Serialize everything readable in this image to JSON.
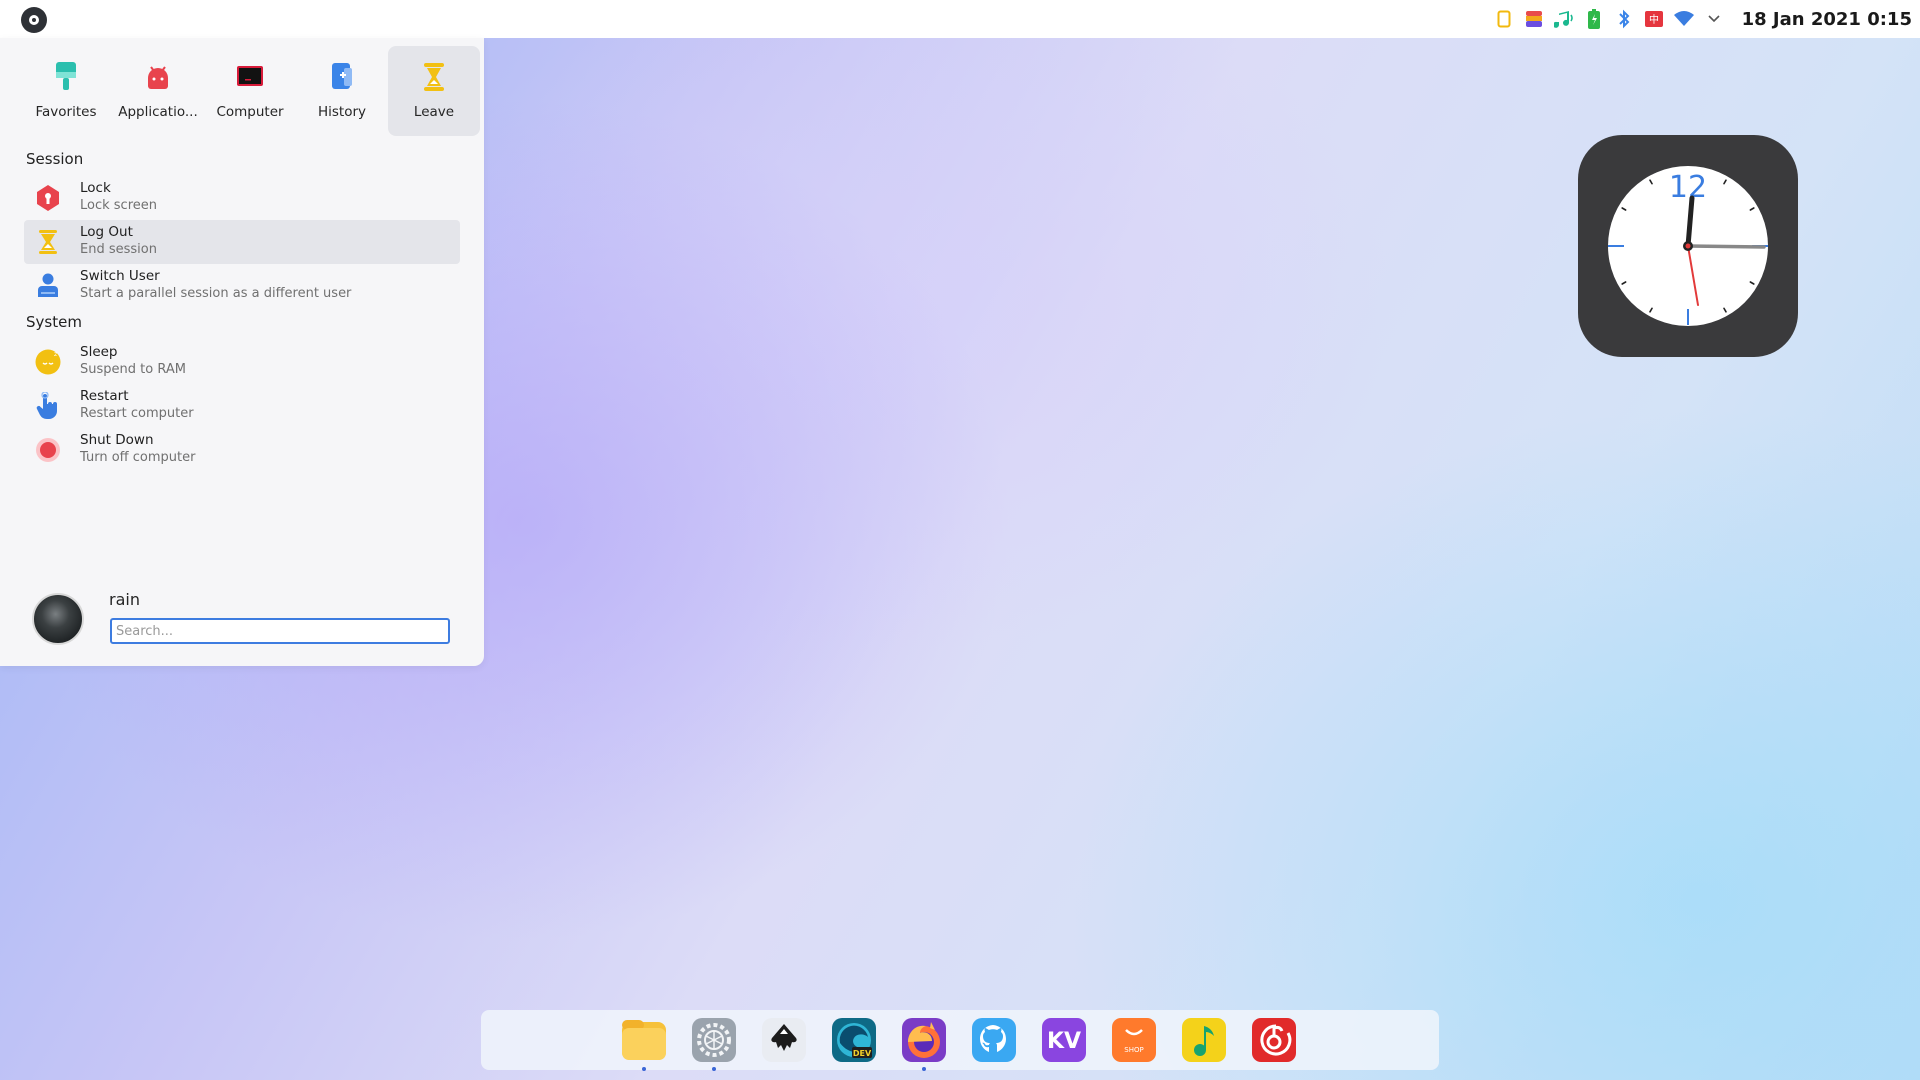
{
  "top_panel": {
    "launcher_icon": "deepin-launcher-icon",
    "tray_icons": [
      "clipboard-icon",
      "app-grid-icon",
      "music-note-icon",
      "battery-icon",
      "bluetooth-icon",
      "input-method-icon",
      "wifi-icon",
      "chevron-down-icon"
    ],
    "datetime": "18 Jan 2021 0:15"
  },
  "start_menu": {
    "tabs": [
      {
        "label": "Favorites",
        "icon": "bookmark-icon",
        "color": "#2bbfae"
      },
      {
        "label": "Applicatio...",
        "icon": "android-icon",
        "color": "#e8434d"
      },
      {
        "label": "Computer",
        "icon": "monitor-icon",
        "color": "#d81b3a"
      },
      {
        "label": "History",
        "icon": "document-icon",
        "color": "#3a84e8"
      },
      {
        "label": "Leave",
        "icon": "hourglass-icon",
        "color": "#f2c012"
      }
    ],
    "active_tab": "Leave",
    "sections": {
      "session": {
        "title": "Session",
        "items": [
          {
            "title": "Lock",
            "subtitle": "Lock screen",
            "icon": "lock-icon"
          },
          {
            "title": "Log Out",
            "subtitle": "End session",
            "icon": "hourglass-icon"
          },
          {
            "title": "Switch User",
            "subtitle": "Start a parallel session as a different user",
            "icon": "user-icon"
          }
        ]
      },
      "system": {
        "title": "System",
        "items": [
          {
            "title": "Sleep",
            "subtitle": "Suspend to RAM",
            "icon": "sleep-icon"
          },
          {
            "title": "Restart",
            "subtitle": "Restart computer",
            "icon": "hand-pointer-icon"
          },
          {
            "title": "Shut Down",
            "subtitle": "Turn off computer",
            "icon": "power-dot-icon"
          }
        ]
      }
    },
    "user": {
      "name": "rain",
      "search_placeholder": "Search..."
    }
  },
  "clock_widget": {
    "numeral": "12",
    "time": "0:15",
    "colors": {
      "background": "#3a3a3c",
      "face": "#ffffff",
      "accent": "#3a7de0",
      "second_hand": "#e23a3a"
    }
  },
  "dock": {
    "apps": [
      {
        "name": "file-manager",
        "icon": "folder-icon",
        "running": true
      },
      {
        "name": "settings",
        "icon": "settings-gear-icon",
        "running": true
      },
      {
        "name": "inkscape",
        "icon": "inkscape-icon",
        "running": false
      },
      {
        "name": "edge-dev",
        "icon": "edge-dev-icon",
        "label": "DEV",
        "running": false
      },
      {
        "name": "firefox",
        "icon": "firefox-icon",
        "running": true
      },
      {
        "name": "github",
        "icon": "github-icon",
        "running": false
      },
      {
        "name": "kv",
        "icon": "kv-icon",
        "label": "KV",
        "running": false
      },
      {
        "name": "app-store",
        "icon": "shop-bag-icon",
        "label": "SHOP",
        "running": false
      },
      {
        "name": "music-player",
        "icon": "music-note-icon",
        "running": false
      },
      {
        "name": "netease-music",
        "icon": "netease-music-icon",
        "running": false
      }
    ]
  }
}
